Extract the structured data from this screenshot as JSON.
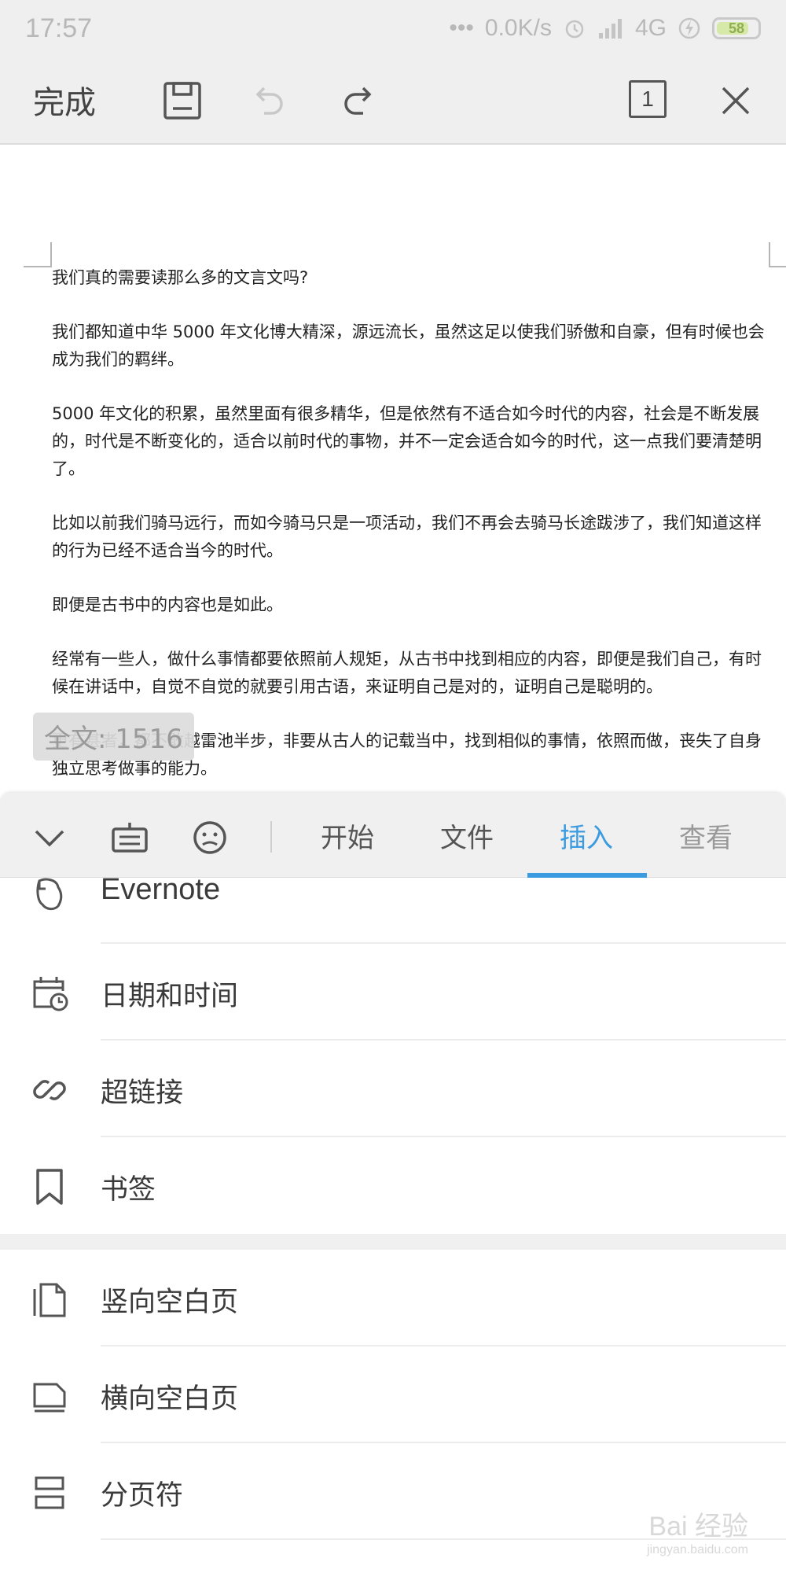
{
  "status_bar": {
    "time": "17:57",
    "dots": "•••",
    "speed": "0.0K/s",
    "network": "4G",
    "battery": "58",
    "icons": [
      "alarm-icon",
      "signal-icon",
      "charging-icon",
      "battery-icon"
    ]
  },
  "toolbar": {
    "done_label": "完成",
    "page_indicator": "1",
    "icons": [
      "save-icon",
      "undo-icon",
      "redo-icon",
      "page-icon",
      "close-icon"
    ]
  },
  "document": {
    "paragraphs": [
      "我们真的需要读那么多的文言文吗?",
      "我们都知道中华 5000 年文化博大精深，源远流长，虽然这足以使我们骄傲和自豪，但有时候也会成为我们的羁绊。",
      "5000 年文化的积累，虽然里面有很多精华，但是依然有不适合如今时代的内容，社会是不断发展的，时代是不断变化的，适合以前时代的事物，并不一定会适合如今的时代，这一点我们要清楚明了。",
      "比如以前我们骑马远行，而如今骑马只是一项活动，我们不再会去骑马长途跋涉了，我们知道这样的行为已经不适合当今的时代。",
      "即便是古书中的内容也是如此。",
      "经常有一些人，做什么事情都要依照前人规矩，从古书中找到相应的内容，即便是我们自己，有时候在讲话中，自觉不自觉的就要引用古语，来证明自己是对的，证明自己是聪明的。",
      "更有甚者，都不敢越雷池半步，非要从古人的记载当中，找到相似的事情，依照而做，丧失了自身独立思考做事的能力。"
    ],
    "word_count": "全文: 1516"
  },
  "panel": {
    "tabs": [
      {
        "label": "开始",
        "active": false
      },
      {
        "label": "文件",
        "active": false
      },
      {
        "label": "插入",
        "active": true
      },
      {
        "label": "查看",
        "active": false
      }
    ],
    "accent_color": "#3a9be0",
    "items": [
      {
        "label": "Evernote",
        "icon": "evernote-icon"
      },
      {
        "label": "日期和时间",
        "icon": "calendar-clock-icon"
      },
      {
        "label": "超链接",
        "icon": "link-icon"
      },
      {
        "label": "书签",
        "icon": "bookmark-icon"
      },
      {
        "label": "竖向空白页",
        "icon": "portrait-page-icon"
      },
      {
        "label": "横向空白页",
        "icon": "landscape-page-icon"
      },
      {
        "label": "分页符",
        "icon": "page-break-icon"
      }
    ]
  },
  "watermark": {
    "text": "Bai 经验",
    "url": "jingyan.baidu.com"
  }
}
